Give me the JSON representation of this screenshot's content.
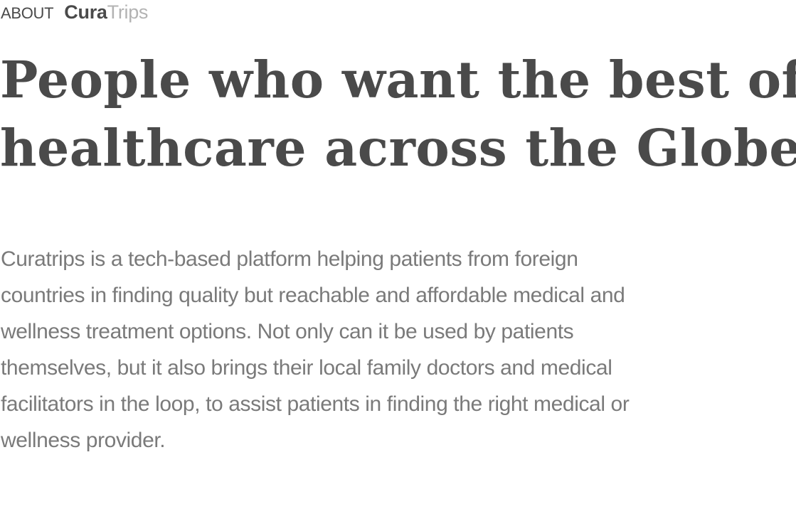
{
  "header": {
    "section_label": "ABOUT",
    "logo": {
      "strong": "Cura",
      "light": "Trips"
    }
  },
  "headline": {
    "lines": [
      "People who want the best of",
      "healthcare across the Globe."
    ]
  },
  "description": {
    "lines": [
      "Curatrips is a tech-based platform helping patients from foreign",
      "countries in finding quality but reachable and affordable medical and",
      "wellness treatment options. Not only can it be used by patients",
      "themselves, but it also brings their local family doctors and medical",
      "facilitators in the loop, to assist patients in finding the right medical or",
      "wellness provider."
    ]
  },
  "colors": {
    "heading": "#4a4a4a",
    "body": "#7a7a7a",
    "logo_light": "#b3b3b3",
    "background": "#ffffff"
  }
}
